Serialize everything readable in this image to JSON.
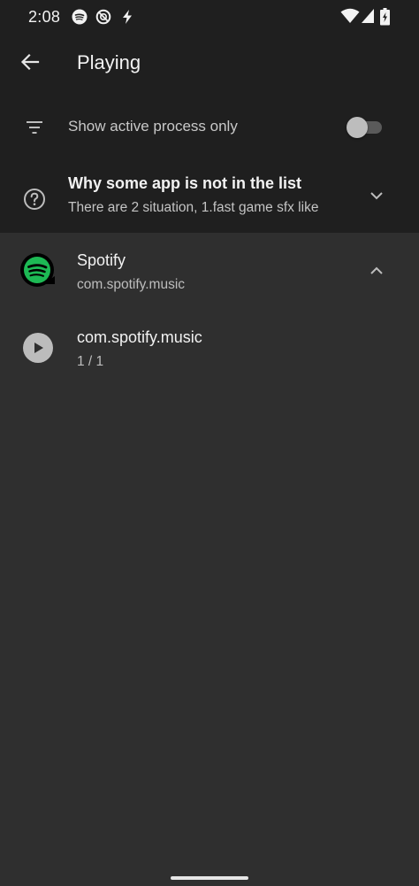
{
  "status_bar": {
    "time": "2:08",
    "left_icons": [
      "spotify-icon",
      "dnd-icon",
      "flash-icon"
    ],
    "right_icons": [
      "wifi-icon",
      "cell-signal-icon",
      "battery-charging-icon"
    ]
  },
  "app_bar": {
    "title": "Playing",
    "back_icon": "arrow-back-icon"
  },
  "filter_row": {
    "label": "Show active process only",
    "icon": "filter-icon",
    "toggle_on": false
  },
  "why_row": {
    "icon": "help-circle-icon",
    "title": "Why some app is not in the list",
    "subtitle": "There are 2 situation, 1.fast game sfx like",
    "expanded": false
  },
  "app_group": {
    "name": "Spotify",
    "package": "com.spotify.music",
    "icon": "spotify-logo-icon",
    "expanded": true,
    "sessions": [
      {
        "title": "com.spotify.music",
        "count": "1 / 1",
        "icon": "play-icon"
      }
    ]
  },
  "colors": {
    "top_background": "#1f1f1f",
    "list_background": "#2f2f2f",
    "spotify_green": "#1db954"
  }
}
